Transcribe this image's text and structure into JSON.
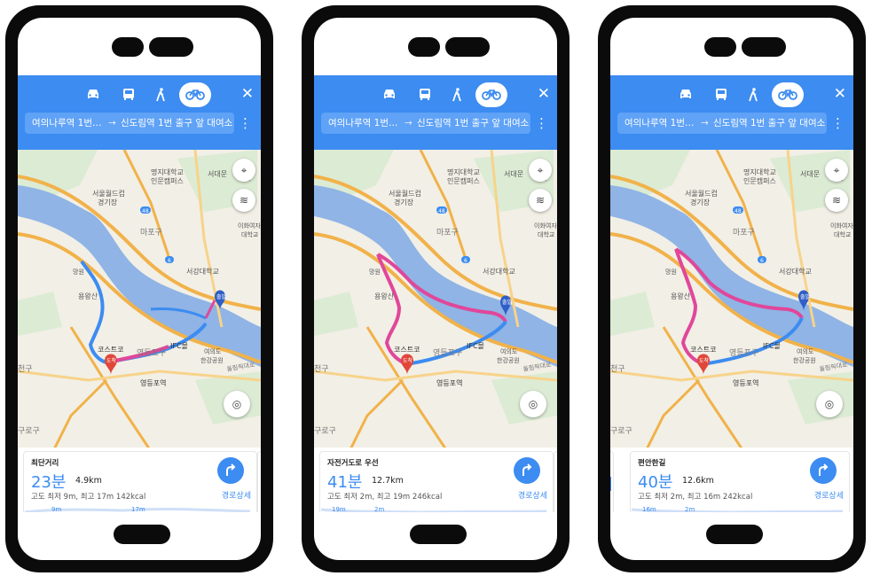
{
  "modes": {
    "car": "car-icon",
    "bus": "bus-icon",
    "walk": "walk-icon",
    "bike": "bike-icon",
    "selected": "bike"
  },
  "route": {
    "from": "여의나루역 1번…",
    "arrow": "→",
    "to": "신도림역 1번 출구 앞 대여소"
  },
  "map_labels": {
    "mapo": "마포구",
    "world_cup": "서울월드컵\n경기장",
    "myongji": "명지대학교\n인문캠퍼스",
    "ansan": "안산",
    "ewha": "이화여자\n대학교",
    "sogang": "서강대학교",
    "mangwon": "망원",
    "mangwon_park": "망원한강공원",
    "yongwang": "용왕산",
    "costco": "코스트코",
    "yeongdeungpo_gu": "영등포구",
    "ifc": "IFC몰",
    "yeouido": "여의도\n한강공원",
    "yeongdeungpo_stn": "영등포역",
    "yangcheon": "양천구",
    "seodaemun": "서대문",
    "guro": "구로구",
    "olympic": "올림픽대로",
    "road48": "48",
    "road6": "6",
    "start": "출발",
    "end": "도착"
  },
  "colors": {
    "blue": "#3c8cf1",
    "pink": "#e0479a",
    "water": "#8fb4e5",
    "road": "#f1b24a"
  },
  "phones": [
    {
      "title": "최단거리",
      "time": "23분",
      "distance": "4.9km",
      "meta": "고도 최저 9m, 최고 17m    142kcal",
      "detail": "경로상세",
      "elev_min": "9m",
      "elev_max": "17m",
      "peek_next_title": "편",
      "peek_next_time": "4",
      "peek_next_elev": "16"
    },
    {
      "title": "자전거도로 우선",
      "time": "41분",
      "distance": "12.7km",
      "meta": "고도 최저 2m, 최고 19m    246kcal",
      "detail": "경로상세",
      "elev_min": "19m",
      "elev_max": "2m",
      "peek_next_title": "최",
      "peek_next_time": "2",
      "peek_next_elev": ""
    },
    {
      "title": "편안한길",
      "time": "40분",
      "distance": "12.6km",
      "meta": "고도 최저 2m, 최고 16m    242kcal",
      "detail": "경로상세",
      "elev_min": "16m",
      "elev_max": "2m",
      "peek_next_title": "",
      "peek_next_time": "",
      "peek_next_elev": ""
    }
  ]
}
